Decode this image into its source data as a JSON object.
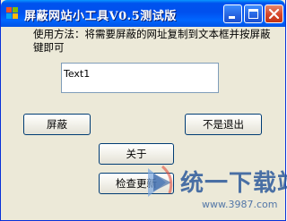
{
  "window": {
    "title": "屏蔽网站小工具V0.5测试版",
    "instruction": "使用方法：将需要屏蔽的网址复制到文本框并按屏蔽键即可"
  },
  "url_input": {
    "value": "Text1"
  },
  "buttons": {
    "shield": "屏蔽",
    "exit": "不是退出",
    "about": "关于",
    "update": "检查更新"
  },
  "watermark": {
    "text": "统一下载站",
    "url": "www.3987.com"
  },
  "colors": {
    "titlebar": "#0053ee",
    "window_bg": "#ece9d8",
    "close_button": "#d6452a",
    "watermark": "#2d5a9c"
  },
  "icons": {
    "app": "flag-icon",
    "minimize": "minimize-icon",
    "maximize": "maximize-icon",
    "close": "close-icon"
  }
}
